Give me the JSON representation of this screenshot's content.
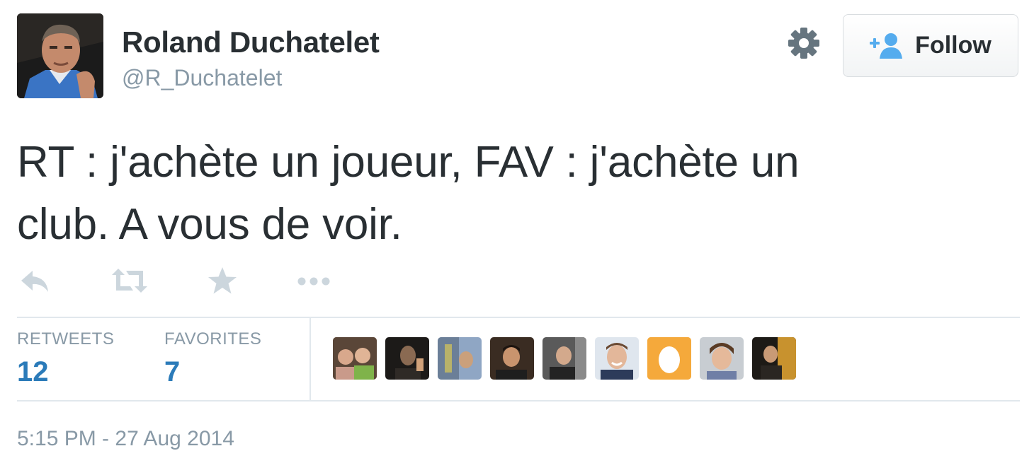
{
  "author": {
    "name": "Roland Duchatelet",
    "handle": "@R_Duchatelet",
    "avatar_icon": "profile-photo"
  },
  "header": {
    "settings_icon": "gear-icon",
    "follow_label": "Follow",
    "follow_icon": "add-user-icon"
  },
  "tweet": {
    "text_line1": "RT : j'achète un joueur, FAV : j'achète un",
    "text_line2": "club. A vous de voir."
  },
  "actions": [
    {
      "icon": "reply-icon"
    },
    {
      "icon": "retweet-icon"
    },
    {
      "icon": "favorite-star-icon"
    },
    {
      "icon": "more-icon"
    }
  ],
  "stats": {
    "retweets_label": "RETWEETS",
    "retweets_count": "12",
    "favorites_label": "FAVORITES",
    "favorites_count": "7"
  },
  "favoriters_count_shown": 9,
  "timestamp": "5:15 PM - 27 Aug 2014",
  "colors": {
    "text": "#292f33",
    "muted": "#8899a6",
    "link": "#2b7bb9",
    "follow_icon": "#55acee",
    "border": "#e1e8ed",
    "egg_bg": "#f5a93b"
  }
}
